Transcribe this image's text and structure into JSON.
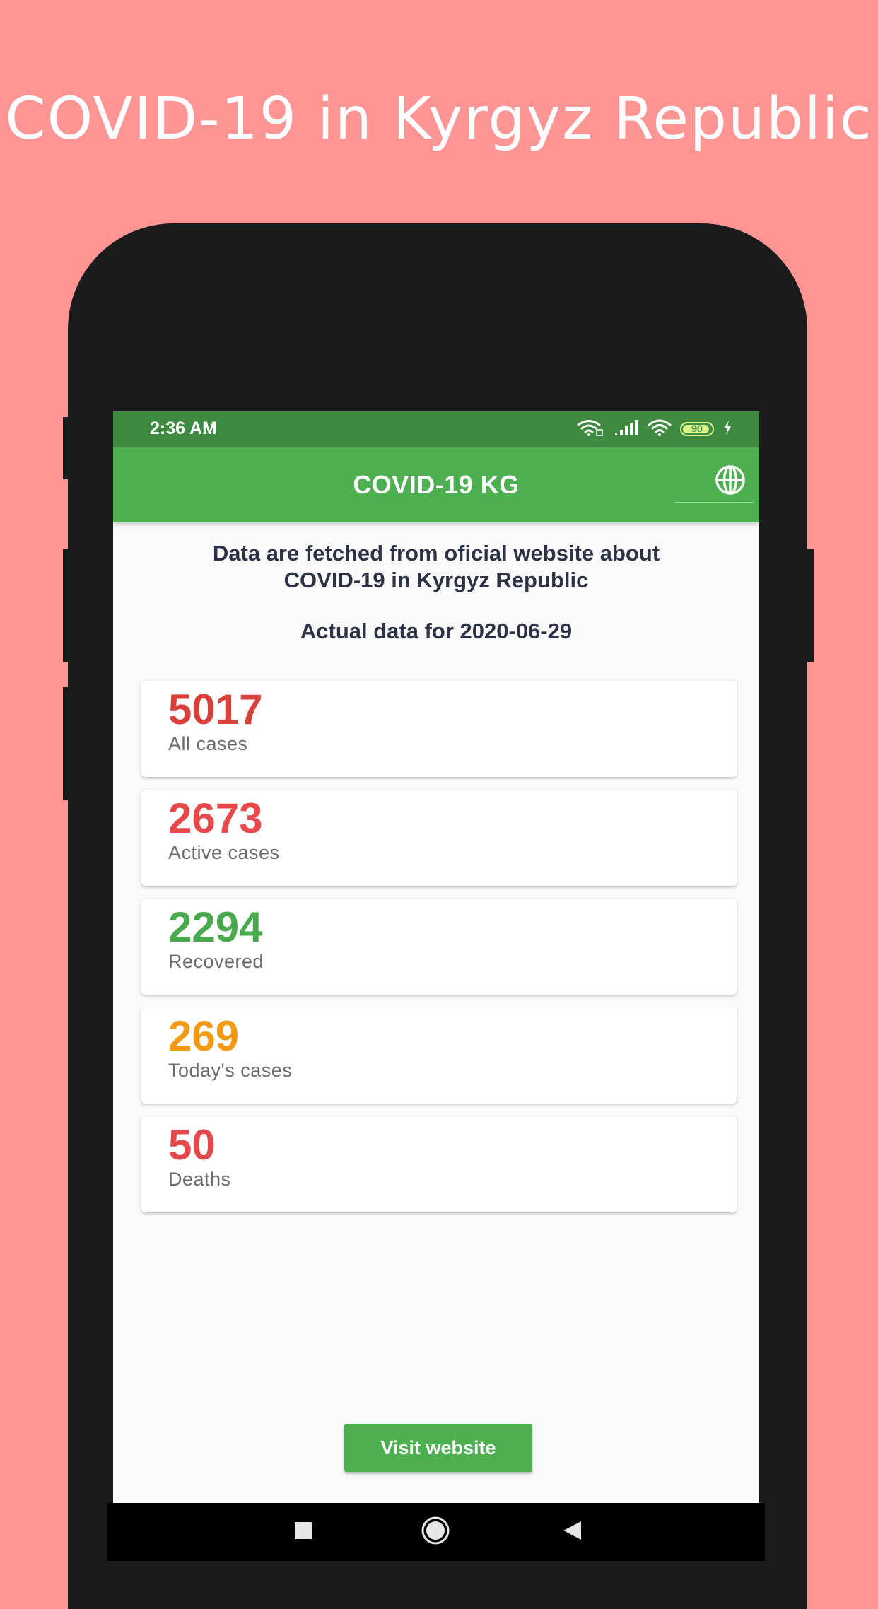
{
  "promo": {
    "title": "COVID-19 in Kyrgyz Republic"
  },
  "status_bar": {
    "time": "2:36 AM",
    "battery": "90",
    "icons": [
      "wifi-calling-icon",
      "signal-icon",
      "wifi-icon",
      "battery-icon",
      "charging-icon"
    ]
  },
  "app_bar": {
    "title": "COVID-19 KG",
    "language_icon": "globe-icon"
  },
  "intro": {
    "line1": "Data are fetched from oficial website about",
    "line2": "COVID-19 in Kyrgyz Republic",
    "date_prefix": "Actual data for",
    "date": "2020-06-29"
  },
  "stats": [
    {
      "value": "5017",
      "label": "All cases",
      "color": "#d8403a"
    },
    {
      "value": "2673",
      "label": "Active cases",
      "color": "#e8484a"
    },
    {
      "value": "2294",
      "label": "Recovered",
      "color": "#4aa94d"
    },
    {
      "value": "269",
      "label": "Today's cases",
      "color": "#f39a12"
    },
    {
      "value": "50",
      "label": "Deaths",
      "color": "#e5474b"
    }
  ],
  "visit_button": {
    "label": "Visit website"
  },
  "colors": {
    "background": "#fd9595",
    "status_bar": "#3f8a41",
    "app_bar": "#4caf50"
  }
}
